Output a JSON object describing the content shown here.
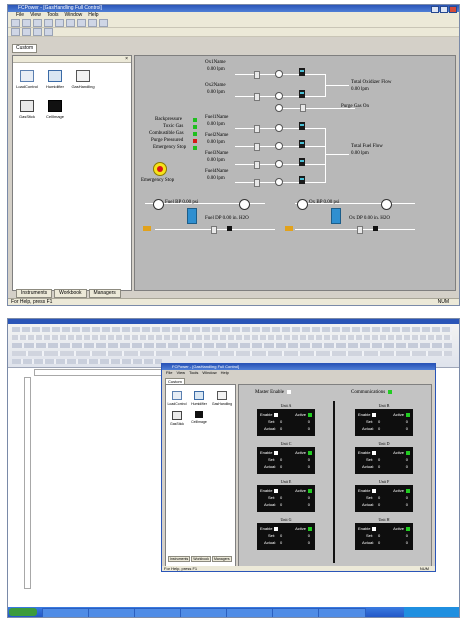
{
  "top": {
    "title": "FCPower - [GasHandling Full Control]",
    "menu": [
      "File",
      "View",
      "Tools",
      "Window",
      "Help"
    ],
    "custom_tab": "Custom",
    "sidebar_close": "×",
    "instruments": [
      {
        "label": "LoadControl",
        "icon": "load-control-icon"
      },
      {
        "label": "Humidifier",
        "icon": "humidifier-icon"
      },
      {
        "label": "GasHandling",
        "icon": "gas-handling-icon"
      },
      {
        "label": "GasStick",
        "icon": "gas-stick-icon"
      },
      {
        "label": "CellImage",
        "icon": "cell-image-icon"
      }
    ],
    "ox1": {
      "name": "Ox1Name",
      "flow": "0.00 lpm"
    },
    "ox2": {
      "name": "Ox2Name",
      "flow": "0.00 lpm"
    },
    "total_ox": {
      "label": "Total Oxidizer Flow",
      "flow": "0.00 lpm"
    },
    "purge": "Purge Gas On",
    "fuel1": {
      "name": "Fuel1Name",
      "flow": "0.00 lpm"
    },
    "fuel2": {
      "name": "Fuel2Name",
      "flow": "0.00 lpm"
    },
    "fuel3": {
      "name": "Fuel3Name",
      "flow": "0.00 lpm"
    },
    "fuel4": {
      "name": "Fuel4Name",
      "flow": "0.00 lpm"
    },
    "total_fuel": {
      "label": "Total Fuel Flow",
      "flow": "0.00 lpm"
    },
    "status_items": [
      {
        "label": "Backpressure",
        "color": "#1fbf1f"
      },
      {
        "label": "Toxic Gas",
        "color": "#1fbf1f"
      },
      {
        "label": "Combustible Gas",
        "color": "#1fbf1f"
      },
      {
        "label": "Purge Pressured",
        "color": "#d81818"
      },
      {
        "label": "Emergency Stop",
        "color": "#1fbf1f"
      }
    ],
    "estop_label": "Emergency Stop",
    "fuel_bp": "Fuel BP 0.00 psi",
    "fuel_dp": "Fuel DP 0.00 in. H2O",
    "ox_bp": "Ox BP 0.00 psi",
    "ox_dp": "Ox DP 0.00 in. H2O",
    "tabs": [
      "Instruments",
      "Workbook",
      "Managers"
    ],
    "status_left": "For Help, press F1",
    "status_right": "NUM"
  },
  "bottom": {
    "inner_title": "FCPower - [GasHandling Full Control]",
    "inner_menu": [
      "File",
      "View",
      "Tools",
      "Window",
      "Help"
    ],
    "custom_tab": "Custom",
    "instruments": [
      {
        "label": "LoadControl",
        "icon": "load-control-icon"
      },
      {
        "label": "Humidifier",
        "icon": "humidifier-icon"
      },
      {
        "label": "GasHandling",
        "icon": "gas-handling-icon"
      },
      {
        "label": "GasStick",
        "icon": "gas-stick-icon"
      },
      {
        "label": "CellImage",
        "icon": "cell-image-icon"
      }
    ],
    "master_enable": "Master Enable",
    "communications": "Communications",
    "units": [
      {
        "name": "Unit A",
        "enable": "Enable",
        "active": "Active",
        "set_label": "Set:",
        "set": "0",
        "actual_label": "Actual:",
        "actual": "0"
      },
      {
        "name": "Unit B",
        "enable": "Enable",
        "active": "Active",
        "set_label": "Set:",
        "set": "0",
        "actual_label": "Actual:",
        "actual": "0"
      },
      {
        "name": "Unit C",
        "enable": "Enable",
        "active": "Active",
        "set_label": "Set:",
        "set": "0",
        "actual_label": "Actual:",
        "actual": "0"
      },
      {
        "name": "Unit D",
        "enable": "Enable",
        "active": "Active",
        "set_label": "Set:",
        "set": "0",
        "actual_label": "Actual:",
        "actual": "0"
      },
      {
        "name": "Unit E",
        "enable": "Enable",
        "active": "Active",
        "set_label": "Set:",
        "set": "0",
        "actual_label": "Actual:",
        "actual": "0"
      },
      {
        "name": "Unit F",
        "enable": "Enable",
        "active": "Active",
        "set_label": "Set:",
        "set": "0",
        "actual_label": "Actual:",
        "actual": "0"
      },
      {
        "name": "Unit G",
        "enable": "Enable",
        "active": "Active",
        "set_label": "Set:",
        "set": "0",
        "actual_label": "Actual:",
        "actual": "0"
      },
      {
        "name": "Unit H",
        "enable": "Enable",
        "active": "Active",
        "set_label": "Set:",
        "set": "0",
        "actual_label": "Actual:",
        "actual": "0"
      }
    ],
    "tabs": [
      "Instruments",
      "Workbook",
      "Managers"
    ],
    "status_left": "For Help, press F1",
    "status_right": "NUM"
  }
}
